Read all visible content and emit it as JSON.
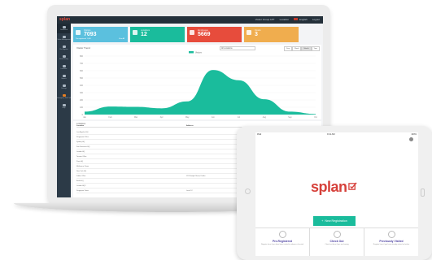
{
  "app": {
    "brand": "splan"
  },
  "topbar": {
    "items": [
      "Visitor Group APT",
      "Location",
      "English",
      "Logout"
    ]
  },
  "sidebar": {
    "items": [
      {
        "label": "Dashboard",
        "icon": "dashboard-icon"
      },
      {
        "label": "Visitor Management",
        "icon": "users-icon"
      },
      {
        "label": "Pre-Register",
        "icon": "calendar-icon"
      },
      {
        "label": "Visitor History",
        "icon": "history-icon"
      },
      {
        "label": "Locations",
        "icon": "location-icon"
      },
      {
        "label": "Reports",
        "icon": "report-icon"
      },
      {
        "label": "Settings",
        "icon": "gear-icon"
      },
      {
        "label": "Emergency Roll Call",
        "icon": "alert-icon"
      },
      {
        "label": "Help",
        "icon": "help-icon"
      }
    ]
  },
  "cards": [
    {
      "title": "Visitors",
      "value": "7093",
      "sub": "Pre-registered: 1,000",
      "link": "View All",
      "color": "#5bc0de"
    },
    {
      "title": "Locations",
      "value": "12",
      "sub": "",
      "link": "",
      "color": "#1abc9c"
    },
    {
      "title": "Employees",
      "value": "5669",
      "sub": "",
      "link": "",
      "color": "#e74c3c"
    },
    {
      "title": "Kiosks",
      "value": "3",
      "sub": "",
      "link": "",
      "color": "#f0ad4e"
    }
  ],
  "chart_panel": {
    "title": "Visitor Trend",
    "select_value": "All Locations",
    "periods": [
      "Day",
      "Week",
      "Month",
      "Year"
    ],
    "active_period": "Month"
  },
  "chart_data": {
    "type": "area",
    "x": [
      "Jan",
      "Feb",
      "Mar",
      "Apr",
      "May",
      "Jun",
      "Jul",
      "Aug",
      "Sep",
      "Oct"
    ],
    "series": [
      {
        "name": "Visitors",
        "values": [
          40,
          110,
          105,
          85,
          180,
          610,
          470,
          210,
          40,
          8
        ],
        "color": "#1abc9c"
      }
    ],
    "ylim": [
      0,
      800
    ],
    "yticks": [
      0,
      100,
      200,
      300,
      400,
      500,
      600,
      700,
      800
    ],
    "grid": true,
    "legend": "top-center"
  },
  "table": {
    "title": "Locations",
    "headers": [
      "Location",
      "Address"
    ],
    "rows": [
      [
        "Los Angeles HQ",
        ""
      ],
      [
        "Singapore Office",
        ""
      ],
      [
        "Sydney HQ",
        ""
      ],
      [
        "San Francisco HQ",
        ""
      ],
      [
        "London HQ",
        ""
      ],
      [
        "Toronto Office",
        ""
      ],
      [
        "Paris HQ",
        ""
      ],
      [
        "Melbourne Tower",
        ""
      ],
      [
        "New York HQ",
        ""
      ],
      [
        "Dublin Office",
        "123 Sample Street, Dublin"
      ],
      [
        "Berlin HQ",
        ""
      ],
      [
        "London HQ2",
        ""
      ],
      [
        "Singapore Tower",
        "Level 12"
      ]
    ]
  },
  "tablet": {
    "status_left": "iPad",
    "status_center": "9:41 AM",
    "status_right": "100%",
    "logo_text": "splan",
    "new_registration": "New Registration",
    "options": [
      {
        "title": "Pre-Registered",
        "desc": "Register here if you have been invited in advance of arrival",
        "icon": "qr-icon"
      },
      {
        "title": "Check Out",
        "desc": "Check out here if you are leaving",
        "icon": "exit-icon"
      },
      {
        "title": "Previously Visited",
        "desc": "Register here if you have already visited us before",
        "icon": "history-icon"
      }
    ]
  }
}
